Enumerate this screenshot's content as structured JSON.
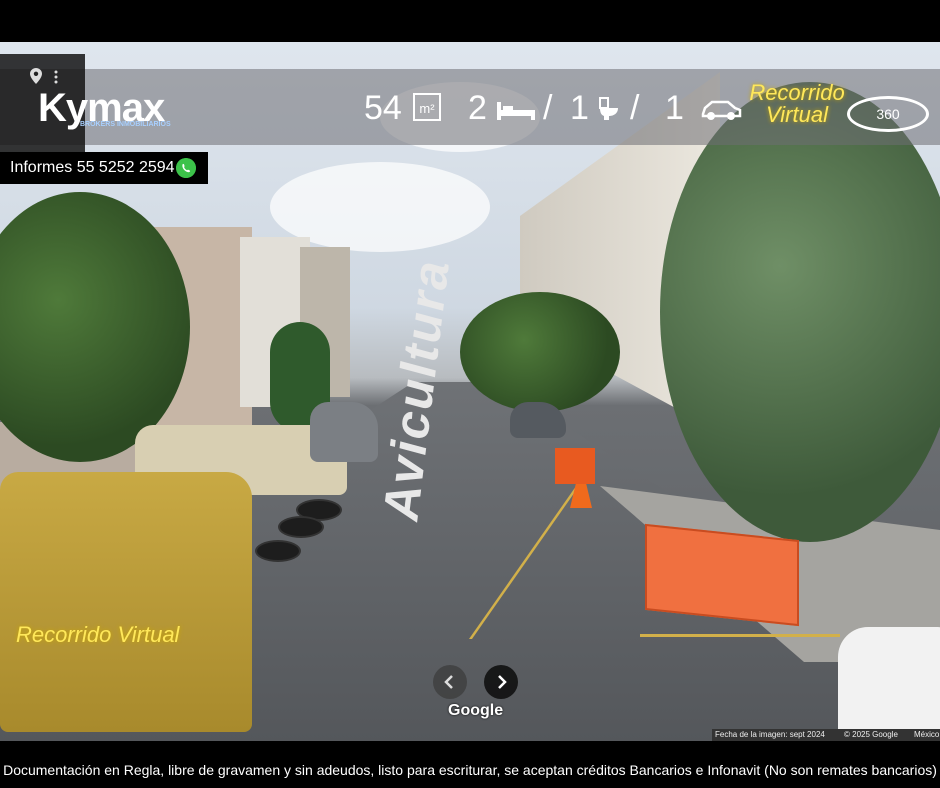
{
  "brand": {
    "logo_text": "Kymax",
    "logo_subtitle": "BROKERS INMOBILIARIOS",
    "phone_label": "Informes 55 5252 2594"
  },
  "stats": {
    "area_value": "54",
    "area_unit": "m²",
    "bedrooms": "2",
    "separator_1": "/",
    "bathrooms": "1",
    "separator_2": "/",
    "parking": "1"
  },
  "tour": {
    "top_label_line1": "Recorrido",
    "top_label_line2": "Virtual",
    "badge_360": "360",
    "scene_label": "Recorrido Virtual"
  },
  "street": {
    "name": "Avicultura"
  },
  "streetview": {
    "prev_icon": "chevron-left-icon",
    "next_icon": "chevron-right-icon",
    "google_label": "Google",
    "image_date": "Fecha de la imagen: sept 2024",
    "copyright": "© 2025 Google",
    "country": "México"
  },
  "footer": {
    "text": "Documentación en Regla, libre de gravamen y sin adeudos, listo para escriturar, se aceptan créditos Bancarios e Infonavit (No son remates bancarios)"
  },
  "colors": {
    "accent_yellow": "#ffe85a",
    "whatsapp_green": "#3cc24a",
    "barrier_orange": "#f07040"
  }
}
